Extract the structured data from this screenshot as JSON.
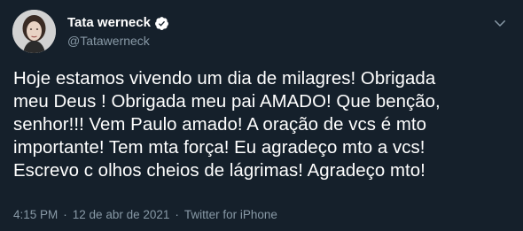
{
  "tweet": {
    "display_name": "Tata werneck",
    "handle": "@Tatawerneck",
    "verified": true,
    "text": "Hoje estamos vivendo um dia de milagres! Obrigada\nmeu Deus ! Obrigada meu pai AMADO! Que benção,\nsenhor!!! Vem Paulo amado! A oração de vcs é mto\nimportante! Tem mta força! Eu agradeço mto a vcs!\nEscrevo c olhos cheios de lágrimas! Agradeço mto!",
    "time": "4:15 PM",
    "date": "12 de abr de 2021",
    "separator": "·",
    "source": "Twitter for iPhone"
  },
  "icons": {
    "verified": "verified-badge-icon",
    "more": "chevron-down-icon"
  },
  "colors": {
    "background": "#15202b",
    "primary_text": "#ffffff",
    "secondary_text": "#8899a6",
    "verified_blue": "#ffffff"
  }
}
